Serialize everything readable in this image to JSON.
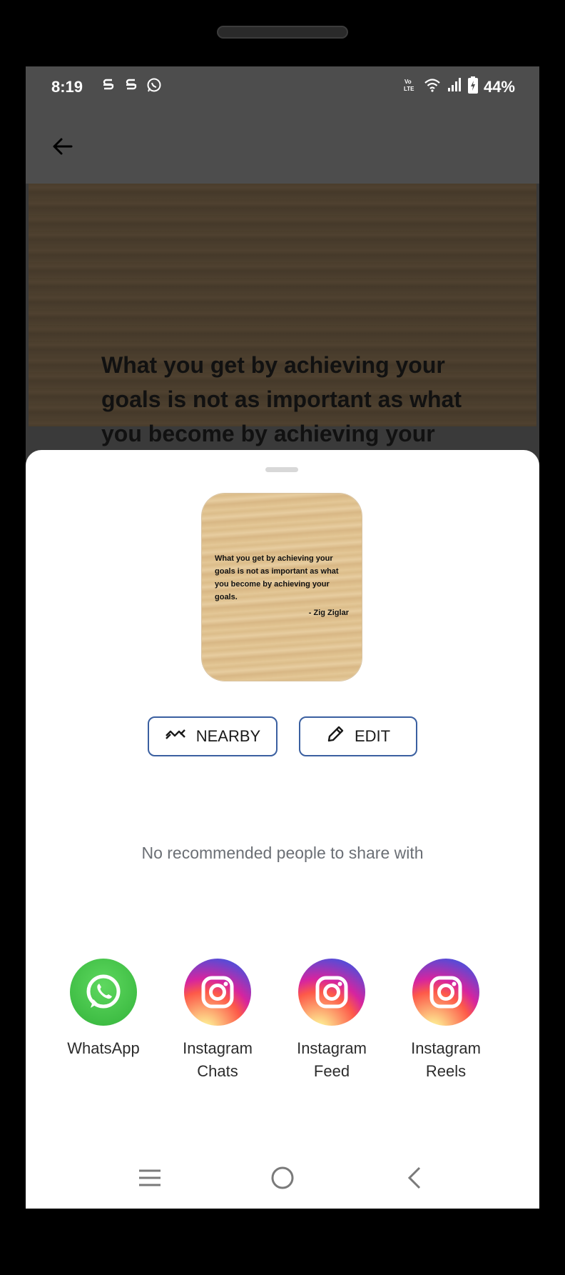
{
  "status_bar": {
    "time": "8:19",
    "battery": "44%",
    "notification_icons": [
      "s-icon",
      "s-icon",
      "whatsapp-icon"
    ],
    "system_icons": [
      "volte-icon",
      "wifi-icon",
      "signal-icon",
      "battery-charging-icon"
    ]
  },
  "background_card": {
    "quote": "What you get by achieving your goals is not as important as what you become by achieving your"
  },
  "share_sheet": {
    "preview": {
      "quote": "What you get by achieving your goals is not as important as what you become by achieving your goals.",
      "author": "- Zig Ziglar"
    },
    "buttons": {
      "nearby": "NEARBY",
      "edit": "EDIT"
    },
    "no_recommendations": "No recommended people to share with",
    "apps": [
      {
        "line1": "WhatsApp",
        "line2": "",
        "icon": "whatsapp-icon"
      },
      {
        "line1": "Instagram",
        "line2": "Chats",
        "icon": "instagram-icon"
      },
      {
        "line1": "Instagram",
        "line2": "Feed",
        "icon": "instagram-icon"
      },
      {
        "line1": "Instagram",
        "line2": "Reels",
        "icon": "instagram-icon"
      }
    ]
  },
  "colors": {
    "accent_border": "#3a5fa0",
    "whatsapp_green": "#33b33a"
  }
}
